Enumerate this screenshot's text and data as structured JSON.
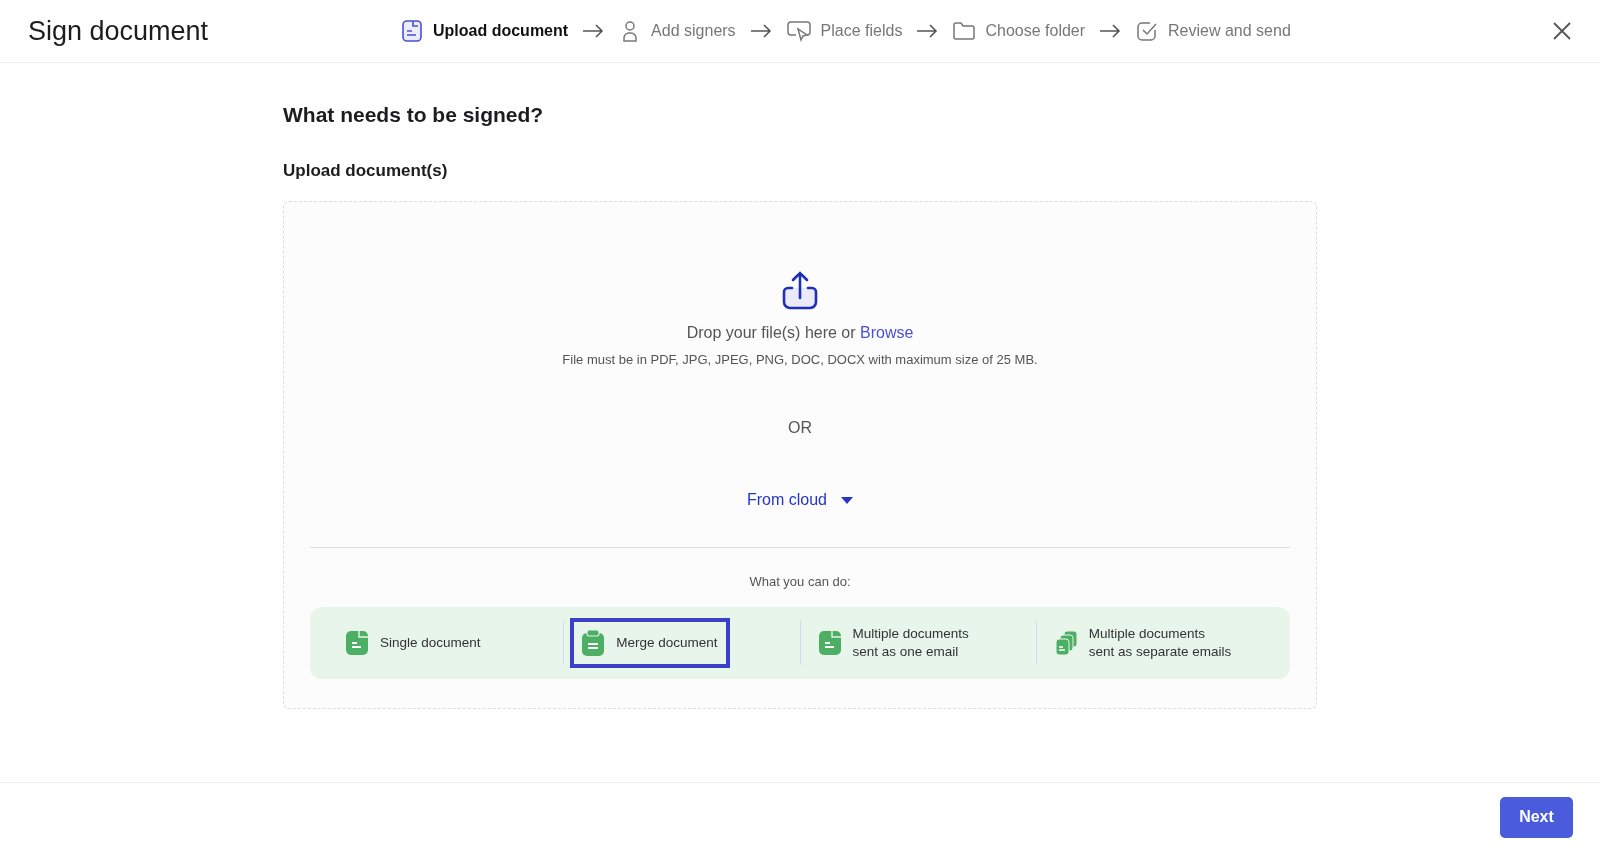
{
  "window": {
    "title": "Sign document"
  },
  "steps": [
    {
      "label": "Upload document",
      "kind": "document",
      "selected": true
    },
    {
      "label": "Add signers",
      "kind": "person",
      "selected": false
    },
    {
      "label": "Place fields",
      "kind": "field",
      "selected": false
    },
    {
      "label": "Choose folder",
      "kind": "folder",
      "selected": false
    },
    {
      "label": "Review and send",
      "kind": "check",
      "selected": false
    }
  ],
  "heading": "What needs to be signed?",
  "upload": {
    "label": "Upload document(s)",
    "drop_text": "Drop your file(s) here or ",
    "browse_link": "Browse",
    "hint": "File must be in PDF, JPG, JPEG, PNG, DOC, DOCX with maximum size of 25 MB.",
    "separator": "OR",
    "cloud_button": "From cloud",
    "options_title": "What you can do:",
    "options": [
      {
        "kind": "single",
        "lines": [
          "Single document"
        ],
        "selected": false
      },
      {
        "kind": "merge",
        "lines": [
          "Merge document"
        ],
        "selected": true
      },
      {
        "kind": "single",
        "lines": [
          "Multiple documents",
          "sent as one email"
        ],
        "selected": false
      },
      {
        "kind": "stack",
        "lines": [
          "Multiple documents",
          "sent as separate emails"
        ],
        "selected": false
      }
    ]
  },
  "buttons": {
    "next": "Next"
  }
}
